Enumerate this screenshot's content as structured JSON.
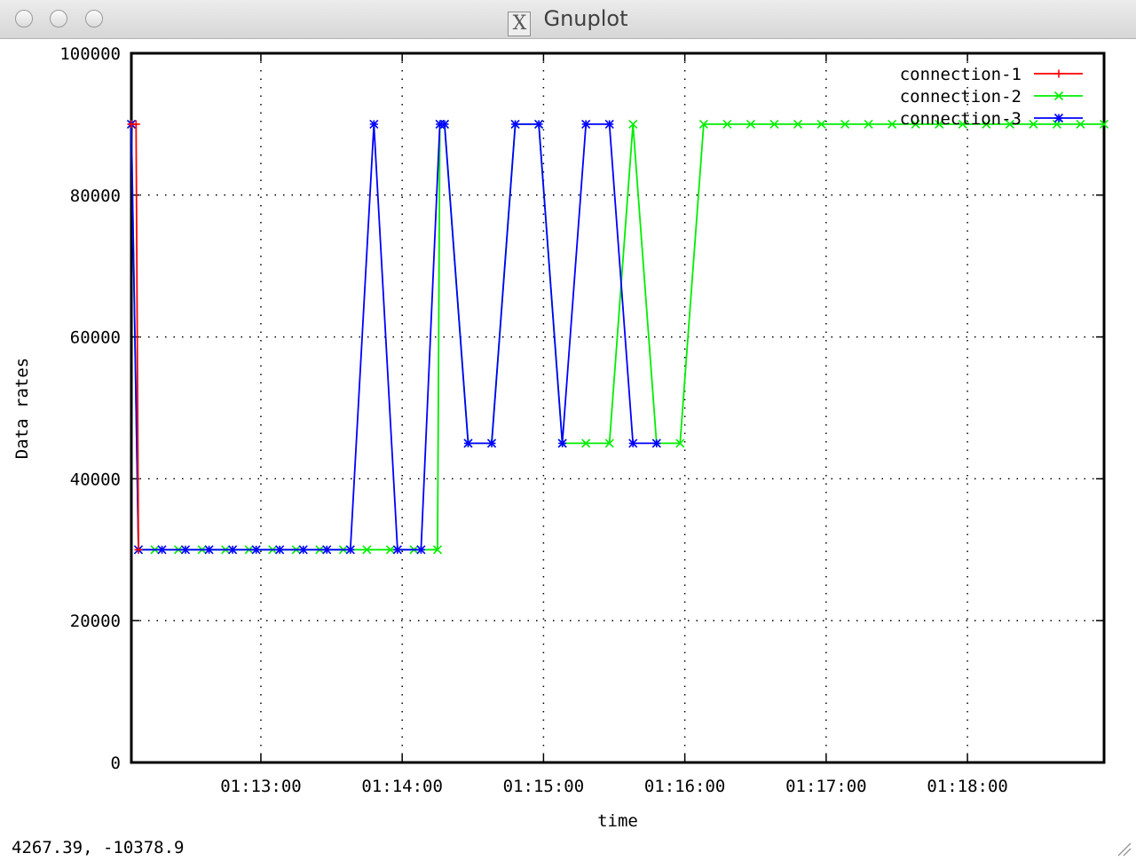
{
  "window": {
    "title": "Gnuplot",
    "icon": "x11-icon"
  },
  "status": {
    "coordinates": "4267.39, -10378.9"
  },
  "chart_data": {
    "type": "line",
    "title": "",
    "xlabel": "time",
    "ylabel": "Data rates",
    "x_unit": "time of day",
    "xlim": [
      "01:12:05",
      "01:18:58"
    ],
    "ylim": [
      0,
      100000
    ],
    "yticks": [
      "0",
      "20000",
      "40000",
      "60000",
      "80000",
      "100000"
    ],
    "xticks": [
      "01:13:00",
      "01:14:00",
      "01:15:00",
      "01:16:00",
      "01:17:00",
      "01:18:00"
    ],
    "grid": true,
    "legend_position": "top-right",
    "series": [
      {
        "name": "connection-1",
        "color": "#ff0000",
        "marker": "plus",
        "x": [
          "01:12:05",
          "01:12:07",
          "01:12:08"
        ],
        "y": [
          90000,
          90000,
          30000
        ]
      },
      {
        "name": "connection-2",
        "color": "#00ee00",
        "marker": "cross",
        "x": [
          "01:12:05",
          "01:12:08",
          "01:12:15",
          "01:12:25",
          "01:12:35",
          "01:12:45",
          "01:12:55",
          "01:13:05",
          "01:13:15",
          "01:13:25",
          "01:13:35",
          "01:13:45",
          "01:13:55",
          "01:14:05",
          "01:14:15",
          "01:14:16",
          "01:14:18",
          "01:14:28",
          "01:14:38",
          "01:14:48",
          "01:14:58",
          "01:15:08",
          "01:15:18",
          "01:15:28",
          "01:15:38",
          "01:15:48",
          "01:15:58",
          "01:16:08",
          "01:16:18",
          "01:16:28",
          "01:16:38",
          "01:16:48",
          "01:16:58",
          "01:17:08",
          "01:17:18",
          "01:17:28",
          "01:17:38",
          "01:17:48",
          "01:17:58",
          "01:18:08",
          "01:18:18",
          "01:18:28",
          "01:18:38",
          "01:18:48",
          "01:18:58"
        ],
        "y": [
          90000,
          30000,
          30000,
          30000,
          30000,
          30000,
          30000,
          30000,
          30000,
          30000,
          30000,
          30000,
          30000,
          30000,
          30000,
          90000,
          90000,
          45000,
          45000,
          90000,
          90000,
          45000,
          45000,
          45000,
          90000,
          45000,
          45000,
          90000,
          90000,
          90000,
          90000,
          90000,
          90000,
          90000,
          90000,
          90000,
          90000,
          90000,
          90000,
          90000,
          90000,
          90000,
          90000,
          90000,
          90000
        ]
      },
      {
        "name": "connection-3",
        "color": "#0000ff",
        "marker": "star",
        "x": [
          "01:12:05",
          "01:12:08",
          "01:12:18",
          "01:12:28",
          "01:12:38",
          "01:12:48",
          "01:12:58",
          "01:13:08",
          "01:13:18",
          "01:13:28",
          "01:13:38",
          "01:13:48",
          "01:13:58",
          "01:14:08",
          "01:14:16",
          "01:14:18",
          "01:14:28",
          "01:14:38",
          "01:14:48",
          "01:14:58",
          "01:15:08",
          "01:15:18",
          "01:15:28",
          "01:15:38",
          "01:15:48"
        ],
        "y": [
          90000,
          30000,
          30000,
          30000,
          30000,
          30000,
          30000,
          30000,
          30000,
          30000,
          30000,
          90000,
          30000,
          30000,
          90000,
          90000,
          45000,
          45000,
          90000,
          90000,
          45000,
          90000,
          90000,
          45000,
          45000
        ]
      }
    ]
  }
}
